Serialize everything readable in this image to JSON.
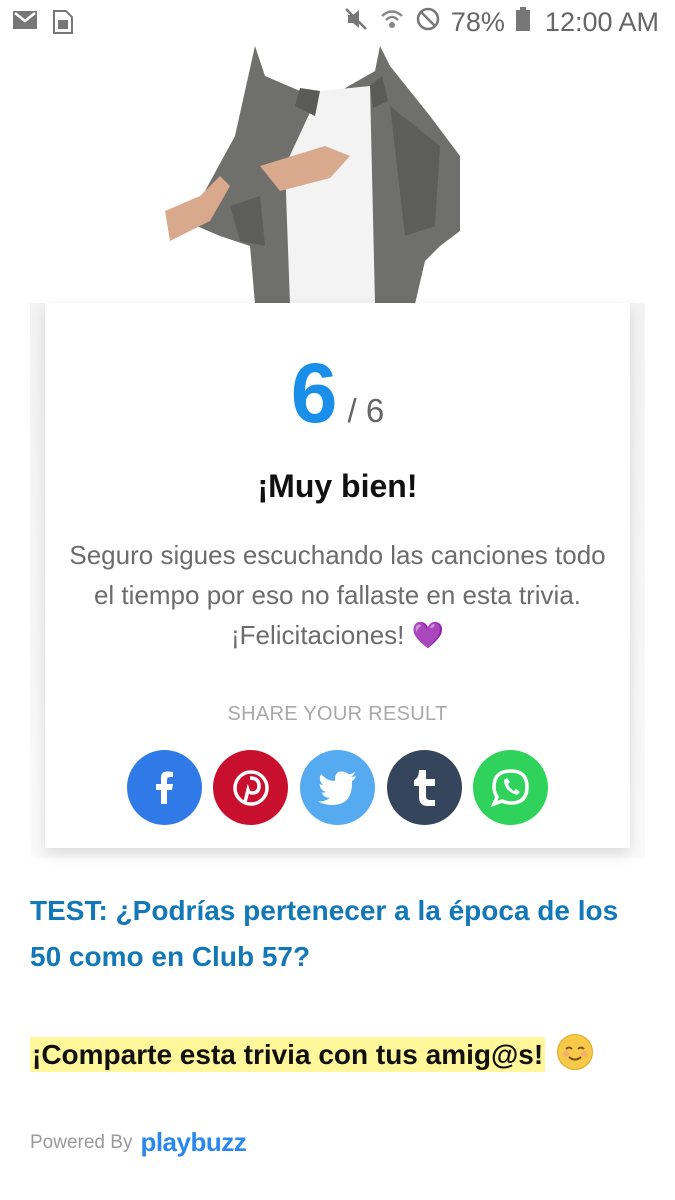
{
  "status_bar": {
    "battery": "78%",
    "time": "12:00 AM",
    "icons": [
      "gmail-icon",
      "sim-icon",
      "mute-icon",
      "wifi-icon",
      "blocked-icon",
      "battery-icon"
    ]
  },
  "result": {
    "score": "6",
    "total": "/ 6",
    "title": "¡Muy bien!",
    "description": "Seguro sigues escuchando las canciones todo el tiempo por eso no fallaste en esta trivia. ¡Felicitaciones!",
    "description_emoji": "💜"
  },
  "share": {
    "label": "SHARE YOUR RESULT",
    "buttons": [
      {
        "name": "facebook",
        "color": "#2f7ae6"
      },
      {
        "name": "pinterest",
        "color": "#c8102e"
      },
      {
        "name": "twitter",
        "color": "#56aaf0"
      },
      {
        "name": "tumblr",
        "color": "#35465c"
      },
      {
        "name": "whatsapp",
        "color": "#2fd25a"
      }
    ]
  },
  "links": {
    "test": "TEST: ¿Podrías pertenecer a la época de los 50 como en Club 57?"
  },
  "cta": {
    "text": "¡Comparte esta trivia con tus amig@s!"
  },
  "footer": {
    "powered_by": "Powered By",
    "brand": "playbuzz"
  }
}
